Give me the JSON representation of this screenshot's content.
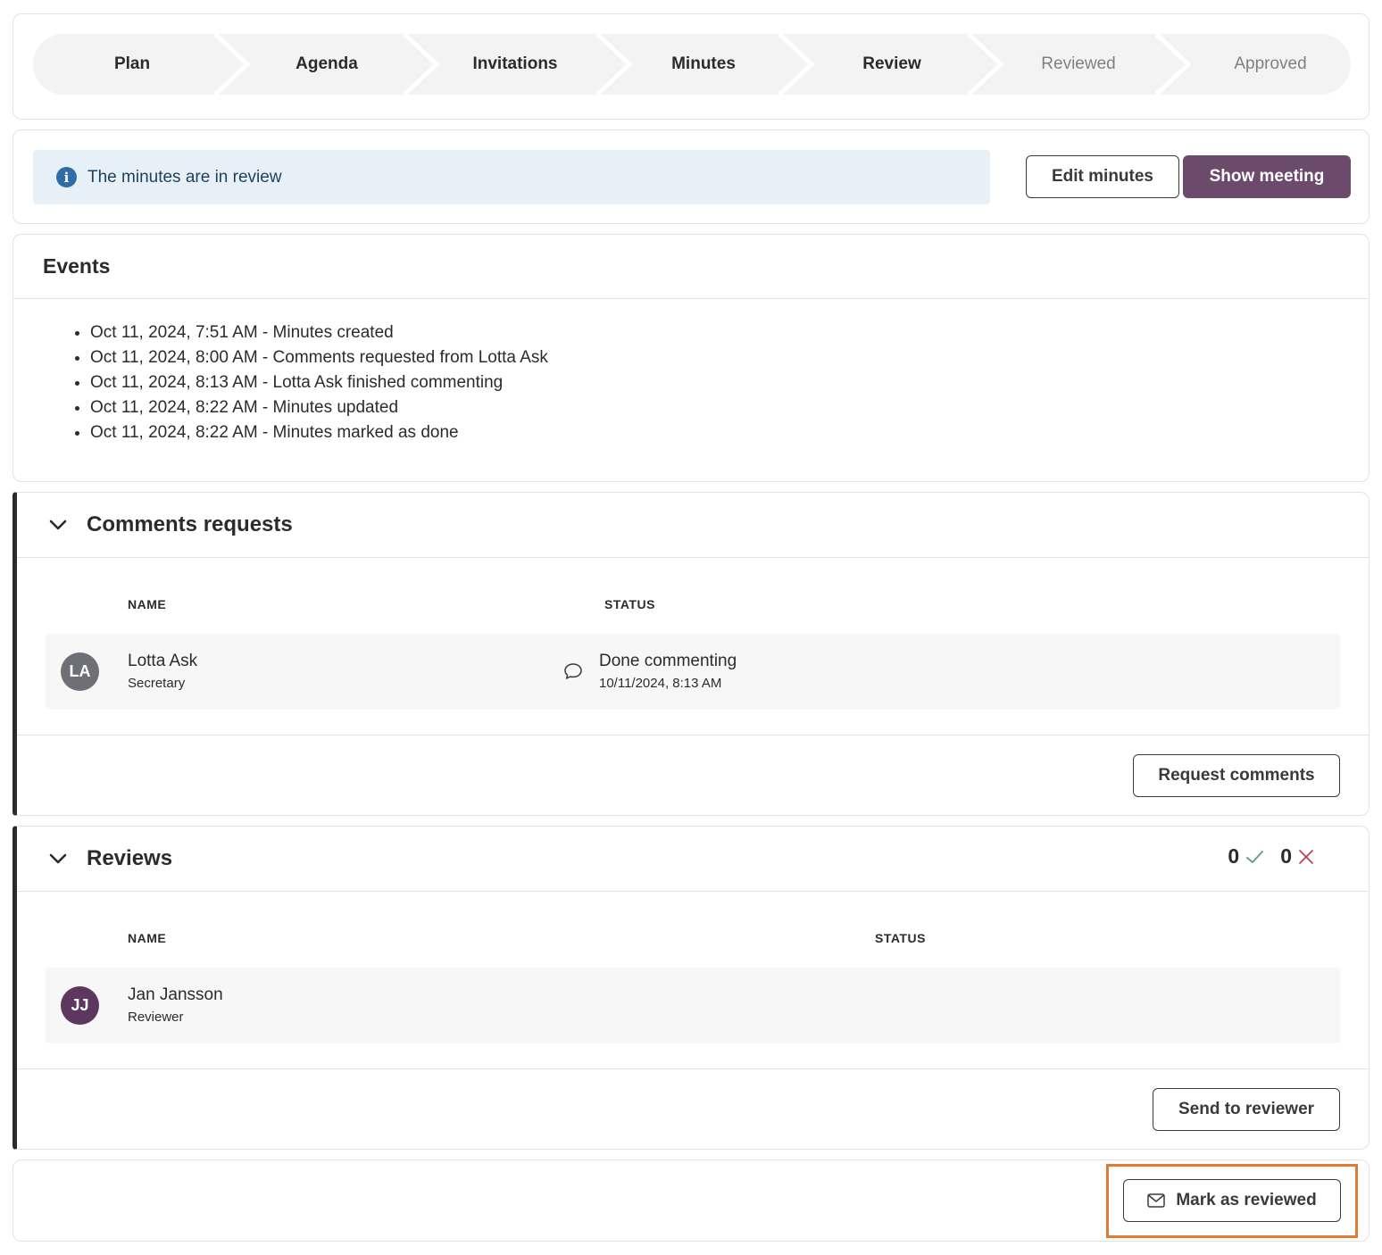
{
  "stepper": {
    "steps": [
      {
        "label": "Plan",
        "state": "done"
      },
      {
        "label": "Agenda",
        "state": "done"
      },
      {
        "label": "Invitations",
        "state": "done"
      },
      {
        "label": "Minutes",
        "state": "done"
      },
      {
        "label": "Review",
        "state": "current"
      },
      {
        "label": "Reviewed",
        "state": "pending"
      },
      {
        "label": "Approved",
        "state": "pending"
      }
    ]
  },
  "banner": {
    "icon": "info-icon",
    "message": "The minutes are in review",
    "edit_label": "Edit minutes",
    "show_label": "Show meeting"
  },
  "events": {
    "title": "Events",
    "items": [
      "Oct 11, 2024, 7:51 AM - Minutes created",
      "Oct 11, 2024, 8:00 AM - Comments requested from Lotta Ask",
      "Oct 11, 2024, 8:13 AM - Lotta Ask finished commenting",
      "Oct 11, 2024, 8:22 AM - Minutes updated",
      "Oct 11, 2024, 8:22 AM - Minutes marked as done"
    ]
  },
  "comments": {
    "title": "Comments requests",
    "col_name": "NAME",
    "col_status": "STATUS",
    "rows": [
      {
        "initials": "LA",
        "name": "Lotta Ask",
        "role": "Secretary",
        "status": "Done commenting",
        "status_time": "10/11/2024, 8:13 AM",
        "status_icon": "comment-icon",
        "avatar_color": "#6f6f76"
      }
    ],
    "action_label": "Request comments"
  },
  "reviews": {
    "title": "Reviews",
    "approved_count": "0",
    "rejected_count": "0",
    "col_name": "NAME",
    "col_status": "STATUS",
    "rows": [
      {
        "initials": "JJ",
        "name": "Jan Jansson",
        "role": "Reviewer",
        "avatar_color": "#5e3760"
      }
    ],
    "action_label": "Send to reviewer"
  },
  "footer": {
    "mark_label": "Mark as reviewed",
    "mark_icon": "envelope-icon"
  },
  "colors": {
    "primary": "#6b4a6b",
    "highlight": "#e27a34",
    "check": "#5a9e7a",
    "cross": "#c0444f"
  }
}
